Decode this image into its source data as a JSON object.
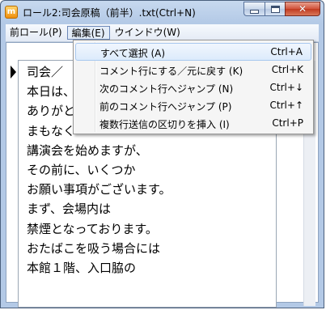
{
  "window": {
    "title": "ロール2:司会原稿（前半）.txt(Ctrl+N)",
    "app_icon_letter": "m",
    "close_glyph": "✕"
  },
  "menubar": {
    "items": [
      {
        "label": "前ロール(P)"
      },
      {
        "label": "編集(E)"
      },
      {
        "label": "ウインドウ(W)"
      }
    ]
  },
  "edit_menu": {
    "items": [
      {
        "label": "すべて選択 (A)",
        "shortcut": "Ctrl+A"
      },
      {
        "label": "コメント行にする／元に戻す (K)",
        "shortcut": "Ctrl+K"
      },
      {
        "label": "次のコメント行へジャンプ (N)",
        "shortcut": "Ctrl+↓"
      },
      {
        "label": "前のコメント行へジャンプ (P)",
        "shortcut": "Ctrl+↑"
      },
      {
        "label": "複数行送信の区切りを挿入 (I)",
        "shortcut": "Ctrl+P"
      }
    ]
  },
  "document": {
    "lines": [
      "司会／",
      "本日は、",
      "ありがと",
      "まもなく",
      "講演会を始めますが、",
      "その前に、いくつか",
      "お願い事項がございます。",
      "まず、会場内は",
      "禁煙となっております。",
      "おたばこを吸う場合には",
      "本館１階、入口脇の"
    ]
  },
  "colors": {
    "title_gradient": "#c7d9ef",
    "close_button": "#c13a20",
    "menu_highlight": "#dcebfc"
  }
}
